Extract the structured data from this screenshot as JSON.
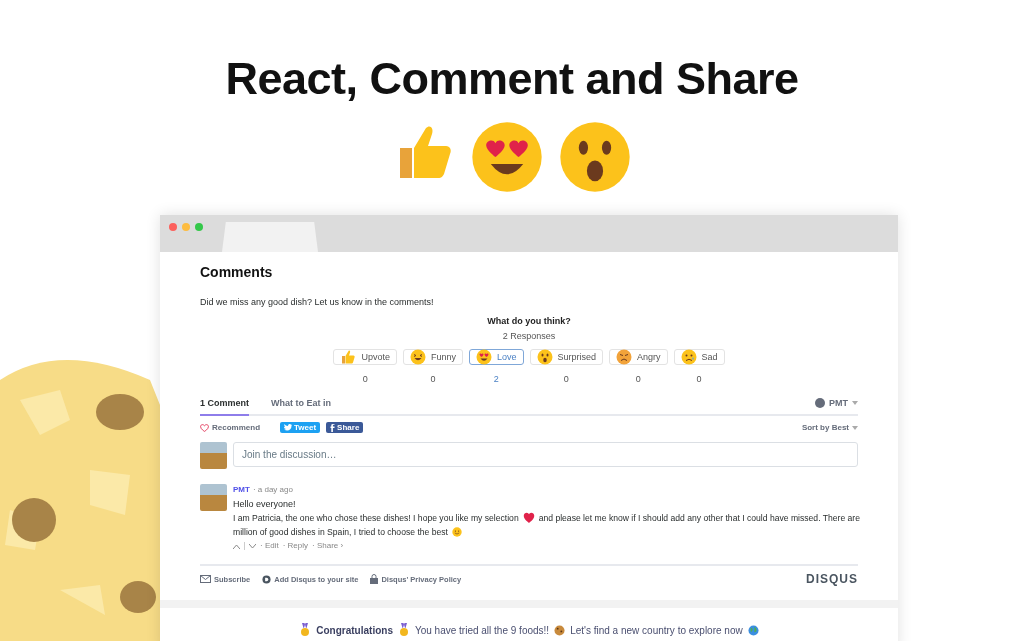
{
  "headline": "React, Comment and Share",
  "browser": {
    "heading": "Comments",
    "intro": "Did we miss any good dish? Let us know in the comments!",
    "reactions": {
      "title": "What do you think?",
      "responses": "2 Responses",
      "items": [
        {
          "label": "Upvote",
          "count": "0",
          "selected": false
        },
        {
          "label": "Funny",
          "count": "0",
          "selected": false
        },
        {
          "label": "Love",
          "count": "2",
          "selected": true
        },
        {
          "label": "Surprised",
          "count": "0",
          "selected": false
        },
        {
          "label": "Angry",
          "count": "0",
          "selected": false
        },
        {
          "label": "Sad",
          "count": "0",
          "selected": false
        }
      ]
    },
    "tabs": [
      {
        "label": "1 Comment",
        "selected": true
      },
      {
        "label": "What to Eat in",
        "selected": false
      }
    ],
    "user": "PMT",
    "recommend": "Recommend",
    "share_buttons": [
      "Tweet",
      "Share"
    ],
    "sort": "Sort by Best",
    "composer": {
      "placeholder": "Join the discussion…"
    },
    "comment": {
      "author": "PMT",
      "time": "· a day ago",
      "greeting": "Hello everyone!",
      "text_1": "I am Patricia, the one who chose these dishes! I hope you like my selection",
      "text_2": "and please let me know if I should add any other that I could have missed. There are",
      "text_3": "million of good dishes in Spain, I tried to choose the best",
      "actions": [
        "· Edit",
        "· Reply",
        "· Share ›"
      ]
    },
    "footer_links": [
      "Subscribe",
      "Add Disqus to your site",
      "Disqus' Privacy Policy"
    ],
    "brand": "DISQUS"
  },
  "banner": {
    "title": "Congratulations",
    "text_1": "You have tried all the 9 foods!!",
    "text_2": "Let's find a new country to explore now"
  }
}
